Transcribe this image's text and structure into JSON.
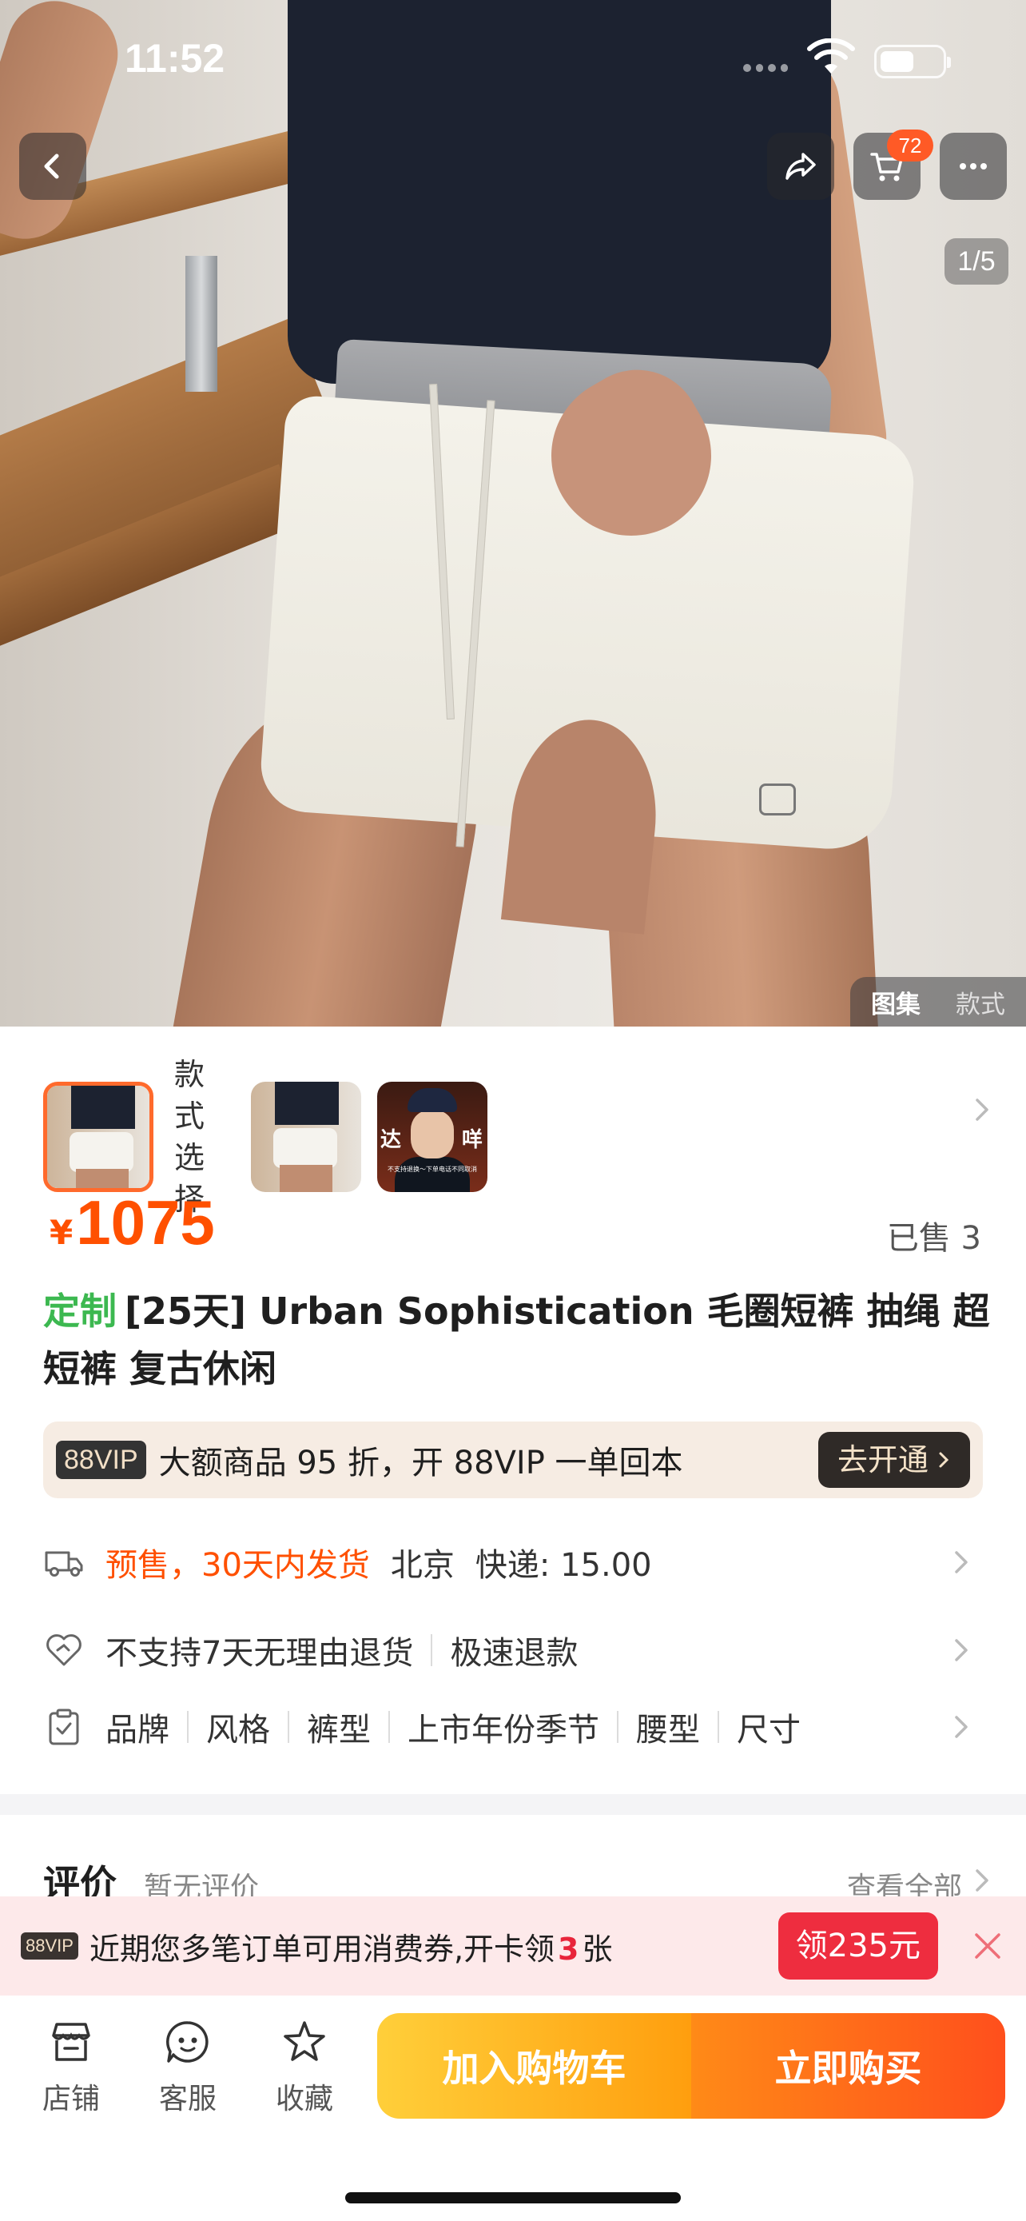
{
  "status_bar": {
    "time": "11:52",
    "battery_fraction": 0.55
  },
  "hero": {
    "cart_badge": "72",
    "page_counter": "1/5",
    "tabs": [
      {
        "label": "图集",
        "active": true
      },
      {
        "label": "款式",
        "active": false
      }
    ]
  },
  "thumbnails": {
    "style_label": "款式选择",
    "avatar_chars": [
      "达",
      "咩"
    ],
    "avatar_caption": "不支持退换～下单电话不同取消"
  },
  "price": {
    "currency": "¥",
    "value": "1075",
    "sold": "已售 3"
  },
  "product": {
    "tag": "定制",
    "title": "[25天] Urban Sophistication 毛圈短裤 抽绳 超短裤 复古休闲"
  },
  "vip_banner": {
    "badge": "88VIP",
    "text": "大额商品 95 折，开 88VIP 一单回本",
    "button": "去开通"
  },
  "shipping": {
    "presale": "预售，30天内发货",
    "city": "北京",
    "express": "快递: 15.00"
  },
  "service": {
    "items": [
      "不支持7天无理由退货",
      "极速退款"
    ]
  },
  "params": {
    "items": [
      "品牌",
      "风格",
      "裤型",
      "上市年份季节",
      "腰型",
      "尺寸"
    ]
  },
  "review": {
    "title": "评价",
    "none": "暂无评价",
    "all": "查看全部"
  },
  "promo": {
    "badge": "88VIP",
    "text_before": "近期您多笔订单可用消费券,开卡领",
    "count": "3",
    "text_after": "张",
    "button": "领235元"
  },
  "bottom_nav": {
    "shop": "店铺",
    "service": "客服",
    "favorite": "收藏",
    "add_to_cart": "加入购物车",
    "buy_now": "立即购买"
  },
  "colors": {
    "accent": "#ff5000",
    "tag_green": "#3cb850",
    "promo_red": "#ee2d3f"
  }
}
